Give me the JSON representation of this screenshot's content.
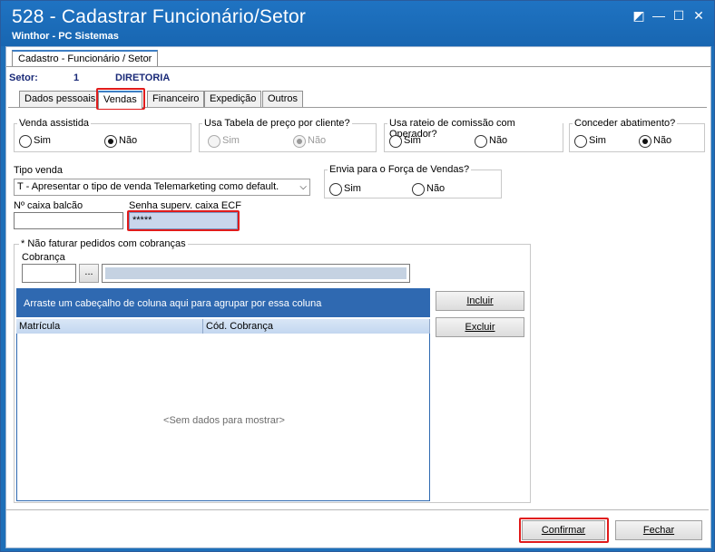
{
  "window": {
    "title": "528 - Cadastrar Funcionário/Setor",
    "subtitle": "Winthor - PC Sistemas",
    "controls": {
      "restore": "◩",
      "minimize": "—",
      "maximize": "☐",
      "close": "✕"
    }
  },
  "outer_tab": {
    "label": "Cadastro - Funcionário / Setor"
  },
  "setor": {
    "label": "Setor:",
    "code": "1",
    "name": "DIRETORIA"
  },
  "tabs": [
    {
      "label": "Dados pessoais"
    },
    {
      "label": "Vendas"
    },
    {
      "label": "Financeiro"
    },
    {
      "label": "Expedição"
    },
    {
      "label": "Outros"
    }
  ],
  "groups": {
    "venda_assistida": {
      "title": "Venda assistida",
      "sim": "Sim",
      "nao": "Não",
      "selected": "Não"
    },
    "tabela_preco": {
      "title": "Usa Tabela de preço por cliente?",
      "sim": "Sim",
      "nao": "Não",
      "selected": "Não",
      "disabled": true
    },
    "rateio_comissao": {
      "title": "Usa rateio de comissão com Operador?",
      "sim": "Sim",
      "nao": "Não",
      "selected": ""
    },
    "abatimento": {
      "title": "Conceder abatimento?",
      "sim": "Sim",
      "nao": "Não",
      "selected": "Não"
    },
    "forca_vendas": {
      "title": "Envia para o Força de Vendas?",
      "sim": "Sim",
      "nao": "Não",
      "selected": ""
    }
  },
  "tipo_venda": {
    "label": "Tipo venda",
    "value": "T - Apresentar o tipo de venda Telemarketing como default."
  },
  "caixa_balcao": {
    "label": "Nº caixa balcão",
    "value": ""
  },
  "senha_caixa": {
    "label": "Senha superv. caixa ECF",
    "value": "*****"
  },
  "cobrancas": {
    "title": "* Não faturar pedidos com cobranças",
    "cobranca_label": "Cobrança",
    "lookup_button": "...",
    "group_panel_text": "Arraste um cabeçalho de coluna aqui para agrupar por essa coluna",
    "columns": [
      "Matrícula",
      "Cód. Cobrança"
    ],
    "empty_text": "<Sem dados para mostrar>",
    "incluir": "Incluir",
    "excluir": "Excluir"
  },
  "footer": {
    "confirmar": "Confirmar",
    "fechar": "Fechar"
  }
}
